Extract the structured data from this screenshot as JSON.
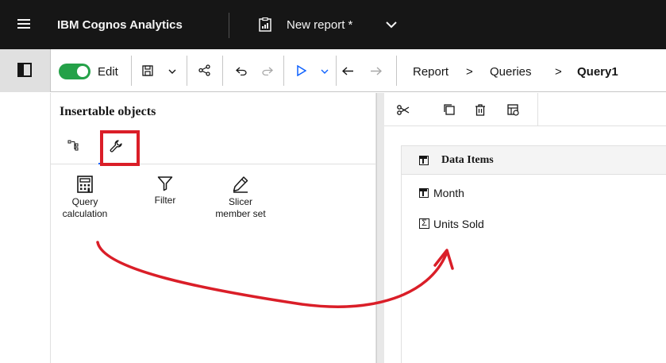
{
  "header": {
    "brand": "IBM Cognos Analytics",
    "report_title": "New report *"
  },
  "toolbar": {
    "edit_label": "Edit",
    "breadcrumb": [
      "Report",
      "Queries",
      "Query1"
    ],
    "separator": ">"
  },
  "left_panel": {
    "title": "Insertable objects",
    "tabs": [
      {
        "name": "tree-tab",
        "icon": "tree-icon"
      },
      {
        "name": "tools-tab",
        "icon": "wrench-icon",
        "active": true
      }
    ],
    "items": [
      {
        "label_line1": "Query",
        "label_line2": "calculation",
        "icon": "calculator-icon"
      },
      {
        "label_line1": "Filter",
        "label_line2": "",
        "icon": "filter-icon"
      },
      {
        "label_line1": "Slicer",
        "label_line2": "member set",
        "icon": "pen-icon"
      }
    ]
  },
  "right_panel": {
    "data_items_header": "Data Items",
    "items": [
      {
        "label": "Month",
        "icon": "column-icon"
      },
      {
        "label": "Units Sold",
        "icon": "sigma-icon"
      }
    ]
  },
  "colors": {
    "header_bg": "#161616",
    "toggle_on": "#24a148",
    "accent_blue": "#0f62fe",
    "annotation_red": "#da1e28"
  }
}
